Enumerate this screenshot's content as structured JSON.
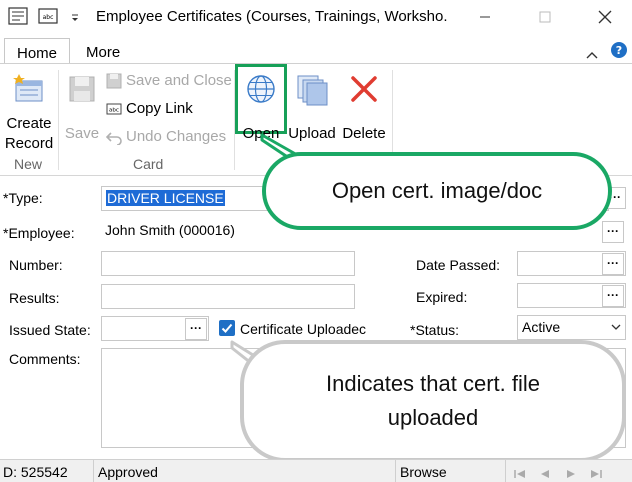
{
  "window": {
    "title": "Employee Certificates (Courses, Trainings, Worksho..."
  },
  "tabs": [
    {
      "label": "Home"
    },
    {
      "label": "More"
    }
  ],
  "ribbon": {
    "create_record": "Create Record",
    "save": "Save",
    "save_and_close": "Save and Close",
    "copy_link": "Copy Link",
    "undo_changes": "Undo Changes",
    "open": "Open",
    "upload": "Upload",
    "delete": "Delete",
    "group_new": "New",
    "group_card": "Card"
  },
  "form": {
    "type_label": "*Type:",
    "type_value": "DRIVER LICENSE",
    "employee_label": "*Employee:",
    "employee_value": "John Smith (000016)",
    "number_label": "Number:",
    "results_label": "Results:",
    "issued_state_label": "Issued State:",
    "comments_label": "Comments:",
    "date_passed_label": "Date Passed:",
    "expired_label": "Expired:",
    "status_label": "*Status:",
    "status_value": "Active",
    "cert_uploaded_label": "Certificate Uploadec",
    "cert_uploaded_checked": true
  },
  "status_bar": {
    "id": "D: 525542",
    "state": "Approved",
    "mode": "Browse"
  },
  "callouts": {
    "open": "Open cert. image/doc",
    "uploaded": "Indicates that cert. file uploaded"
  },
  "colors": {
    "accent_green": "#1aa865",
    "delete_red": "#e03c31",
    "selection_blue": "#1e6bd6",
    "checkbox_blue": "#1f6fc5",
    "open_highlight": "#17a058"
  }
}
